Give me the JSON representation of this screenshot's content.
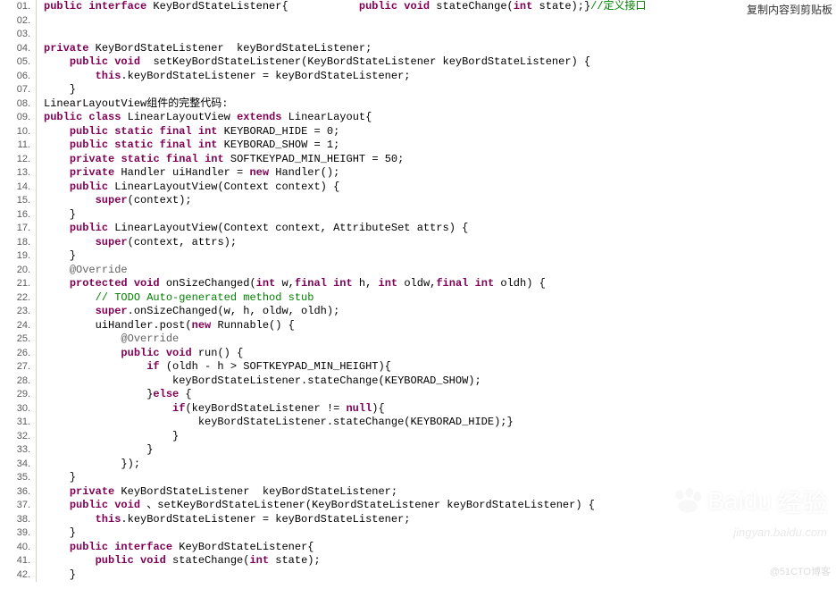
{
  "copy_label": "复制内容到剪贴板",
  "watermark_main": "经验",
  "watermark_brand": "Baidu",
  "watermark_url": "jingyan.baidu.com",
  "watermark_footer": "@51CTO博客",
  "code": {
    "lines": [
      {
        "n": "01.",
        "segs": [
          {
            "t": "public",
            "c": "kw"
          },
          {
            "t": " "
          },
          {
            "t": "interface",
            "c": "kw"
          },
          {
            "t": " KeyBordStateListener{           "
          },
          {
            "t": "public",
            "c": "kw"
          },
          {
            "t": " "
          },
          {
            "t": "void",
            "c": "kw"
          },
          {
            "t": " stateChange("
          },
          {
            "t": "int",
            "c": "kw"
          },
          {
            "t": " state);}"
          },
          {
            "t": "//定义接口",
            "c": "comment"
          }
        ]
      },
      {
        "n": "02.",
        "segs": [
          {
            "t": " "
          }
        ]
      },
      {
        "n": "03.",
        "segs": [
          {
            "t": " "
          }
        ]
      },
      {
        "n": "04.",
        "segs": [
          {
            "t": "private",
            "c": "kw"
          },
          {
            "t": " KeyBordStateListener  keyBordStateListener;"
          }
        ]
      },
      {
        "n": "05.",
        "segs": [
          {
            "t": "    "
          },
          {
            "t": "public",
            "c": "kw"
          },
          {
            "t": " "
          },
          {
            "t": "void",
            "c": "kw"
          },
          {
            "t": "  setKeyBordStateListener(KeyBordStateListener keyBordStateListener) {"
          }
        ]
      },
      {
        "n": "06.",
        "segs": [
          {
            "t": "        "
          },
          {
            "t": "this",
            "c": "kw"
          },
          {
            "t": ".keyBordStateListener = keyBordStateListener;"
          }
        ]
      },
      {
        "n": "07.",
        "segs": [
          {
            "t": "    }"
          }
        ]
      },
      {
        "n": "08.",
        "segs": [
          {
            "t": "LinearLayoutView组件的完整代码:"
          }
        ]
      },
      {
        "n": "09.",
        "segs": [
          {
            "t": "public",
            "c": "kw"
          },
          {
            "t": " "
          },
          {
            "t": "class",
            "c": "kw"
          },
          {
            "t": " LinearLayoutView "
          },
          {
            "t": "extends",
            "c": "kw"
          },
          {
            "t": " LinearLayout{"
          }
        ]
      },
      {
        "n": "10.",
        "segs": [
          {
            "t": "    "
          },
          {
            "t": "public",
            "c": "kw"
          },
          {
            "t": " "
          },
          {
            "t": "static",
            "c": "kw"
          },
          {
            "t": " "
          },
          {
            "t": "final",
            "c": "kw"
          },
          {
            "t": " "
          },
          {
            "t": "int",
            "c": "kw"
          },
          {
            "t": " KEYBORAD_HIDE = "
          },
          {
            "t": "0"
          },
          {
            "t": ";"
          }
        ]
      },
      {
        "n": "11.",
        "segs": [
          {
            "t": "    "
          },
          {
            "t": "public",
            "c": "kw"
          },
          {
            "t": " "
          },
          {
            "t": "static",
            "c": "kw"
          },
          {
            "t": " "
          },
          {
            "t": "final",
            "c": "kw"
          },
          {
            "t": " "
          },
          {
            "t": "int",
            "c": "kw"
          },
          {
            "t": " KEYBORAD_SHOW = "
          },
          {
            "t": "1"
          },
          {
            "t": ";"
          }
        ]
      },
      {
        "n": "12.",
        "segs": [
          {
            "t": "    "
          },
          {
            "t": "private",
            "c": "kw"
          },
          {
            "t": " "
          },
          {
            "t": "static",
            "c": "kw"
          },
          {
            "t": " "
          },
          {
            "t": "final",
            "c": "kw"
          },
          {
            "t": " "
          },
          {
            "t": "int",
            "c": "kw"
          },
          {
            "t": " SOFTKEYPAD_MIN_HEIGHT = "
          },
          {
            "t": "50"
          },
          {
            "t": ";"
          }
        ]
      },
      {
        "n": "13.",
        "segs": [
          {
            "t": "    "
          },
          {
            "t": "private",
            "c": "kw"
          },
          {
            "t": " Handler uiHandler = "
          },
          {
            "t": "new",
            "c": "kw"
          },
          {
            "t": " Handler();"
          }
        ]
      },
      {
        "n": "14.",
        "segs": [
          {
            "t": "    "
          },
          {
            "t": "public",
            "c": "kw"
          },
          {
            "t": " LinearLayoutView(Context context) {"
          }
        ]
      },
      {
        "n": "15.",
        "segs": [
          {
            "t": "        "
          },
          {
            "t": "super",
            "c": "kw"
          },
          {
            "t": "(context);"
          }
        ]
      },
      {
        "n": "16.",
        "segs": [
          {
            "t": "    }"
          }
        ]
      },
      {
        "n": "17.",
        "segs": [
          {
            "t": "    "
          },
          {
            "t": "public",
            "c": "kw"
          },
          {
            "t": " LinearLayoutView(Context context, AttributeSet attrs) {"
          }
        ]
      },
      {
        "n": "18.",
        "segs": [
          {
            "t": "        "
          },
          {
            "t": "super",
            "c": "kw"
          },
          {
            "t": "(context, attrs);"
          }
        ]
      },
      {
        "n": "19.",
        "segs": [
          {
            "t": "    }"
          }
        ]
      },
      {
        "n": "20.",
        "segs": [
          {
            "t": "    "
          },
          {
            "t": "@Override",
            "c": "annot"
          }
        ]
      },
      {
        "n": "21.",
        "segs": [
          {
            "t": "    "
          },
          {
            "t": "protected",
            "c": "kw"
          },
          {
            "t": " "
          },
          {
            "t": "void",
            "c": "kw"
          },
          {
            "t": " onSizeChanged("
          },
          {
            "t": "int",
            "c": "kw"
          },
          {
            "t": " w,"
          },
          {
            "t": "final",
            "c": "kw"
          },
          {
            "t": " "
          },
          {
            "t": "int",
            "c": "kw"
          },
          {
            "t": " h, "
          },
          {
            "t": "int",
            "c": "kw"
          },
          {
            "t": " oldw,"
          },
          {
            "t": "final",
            "c": "kw"
          },
          {
            "t": " "
          },
          {
            "t": "int",
            "c": "kw"
          },
          {
            "t": " oldh) {"
          }
        ]
      },
      {
        "n": "22.",
        "segs": [
          {
            "t": "        "
          },
          {
            "t": "// TODO Auto-generated method stub",
            "c": "comment"
          }
        ]
      },
      {
        "n": "23.",
        "segs": [
          {
            "t": "        "
          },
          {
            "t": "super",
            "c": "kw"
          },
          {
            "t": ".onSizeChanged(w, h, oldw, oldh);"
          }
        ]
      },
      {
        "n": "24.",
        "segs": [
          {
            "t": "        uiHandler.post("
          },
          {
            "t": "new",
            "c": "kw"
          },
          {
            "t": " Runnable() {"
          }
        ]
      },
      {
        "n": "25.",
        "segs": [
          {
            "t": "            "
          },
          {
            "t": "@Override",
            "c": "annot"
          }
        ]
      },
      {
        "n": "26.",
        "segs": [
          {
            "t": "            "
          },
          {
            "t": "public",
            "c": "kw"
          },
          {
            "t": " "
          },
          {
            "t": "void",
            "c": "kw"
          },
          {
            "t": " run() {"
          }
        ]
      },
      {
        "n": "27.",
        "segs": [
          {
            "t": "                "
          },
          {
            "t": "if",
            "c": "kw"
          },
          {
            "t": " (oldh - h > SOFTKEYPAD_MIN_HEIGHT){"
          }
        ]
      },
      {
        "n": "28.",
        "segs": [
          {
            "t": "                    keyBordStateListener.stateChange(KEYBORAD_SHOW);"
          }
        ]
      },
      {
        "n": "29.",
        "segs": [
          {
            "t": "                }"
          },
          {
            "t": "else",
            "c": "kw"
          },
          {
            "t": " {"
          }
        ]
      },
      {
        "n": "30.",
        "segs": [
          {
            "t": "                    "
          },
          {
            "t": "if",
            "c": "kw"
          },
          {
            "t": "(keyBordStateListener != "
          },
          {
            "t": "null",
            "c": "kw"
          },
          {
            "t": "){"
          }
        ]
      },
      {
        "n": "31.",
        "segs": [
          {
            "t": "                        keyBordStateListener.stateChange(KEYBORAD_HIDE);}"
          }
        ]
      },
      {
        "n": "32.",
        "segs": [
          {
            "t": "                    }"
          }
        ]
      },
      {
        "n": "33.",
        "segs": [
          {
            "t": "                }"
          }
        ]
      },
      {
        "n": "34.",
        "segs": [
          {
            "t": "            });"
          }
        ]
      },
      {
        "n": "35.",
        "segs": [
          {
            "t": "    }"
          }
        ]
      },
      {
        "n": "36.",
        "segs": [
          {
            "t": "    "
          },
          {
            "t": "private",
            "c": "kw"
          },
          {
            "t": " KeyBordStateListener  keyBordStateListener;"
          }
        ]
      },
      {
        "n": "37.",
        "segs": [
          {
            "t": "    "
          },
          {
            "t": "public",
            "c": "kw"
          },
          {
            "t": " "
          },
          {
            "t": "void",
            "c": "kw"
          },
          {
            "t": " 、setKeyBordStateListener(KeyBordStateListener keyBordStateListener) {"
          }
        ]
      },
      {
        "n": "38.",
        "segs": [
          {
            "t": "        "
          },
          {
            "t": "this",
            "c": "kw"
          },
          {
            "t": ".keyBordStateListener = keyBordStateListener;"
          }
        ]
      },
      {
        "n": "39.",
        "segs": [
          {
            "t": "    }"
          }
        ]
      },
      {
        "n": "40.",
        "segs": [
          {
            "t": "    "
          },
          {
            "t": "public",
            "c": "kw"
          },
          {
            "t": " "
          },
          {
            "t": "interface",
            "c": "kw"
          },
          {
            "t": " KeyBordStateListener{"
          }
        ]
      },
      {
        "n": "41.",
        "segs": [
          {
            "t": "        "
          },
          {
            "t": "public",
            "c": "kw"
          },
          {
            "t": " "
          },
          {
            "t": "void",
            "c": "kw"
          },
          {
            "t": " stateChange("
          },
          {
            "t": "int",
            "c": "kw"
          },
          {
            "t": " state);"
          }
        ]
      },
      {
        "n": "42.",
        "segs": [
          {
            "t": "    }"
          }
        ]
      }
    ]
  }
}
